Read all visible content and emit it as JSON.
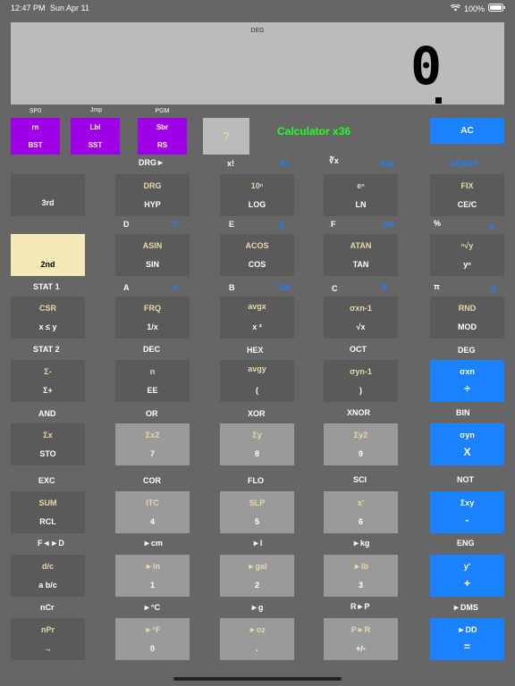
{
  "status_bar": {
    "time": "12:47 PM",
    "date": "Sun Apr 11",
    "battery": "100%"
  },
  "display": {
    "angle_mode": "DEG",
    "value": "0"
  },
  "prog_keys": [
    {
      "label_above": "SP0",
      "top": "rn",
      "bottom": "BST"
    },
    {
      "label_above": "Jmp",
      "top": "Lbl",
      "bottom": "SST"
    },
    {
      "label_above": "PGM",
      "top": "Sbr",
      "bottom": "RS"
    }
  ],
  "help_label": "?",
  "app_title": "Calculator x36",
  "ac_label": "AC",
  "row_labels": {
    "r1": {
      "drg": "DRG►",
      "xfact": "x!",
      "k1": "KI",
      "xrt": "∛x",
      "km": "Km",
      "const": "CONST"
    },
    "r2": {
      "d": "D",
      "c": "C",
      "e": "E",
      "g": "g",
      "f": "F",
      "me": "me",
      "pct": "%",
      "e2": "e"
    },
    "r3": {
      "stat1": "STAT 1",
      "a": "A",
      "h": "h",
      "b": "B",
      "na": "NA",
      "c": "C",
      "r": "R",
      "pi": "π",
      "g": "G"
    },
    "r4": {
      "stat2": "STAT 2",
      "dec": "DEC",
      "hex": "HEX",
      "oct": "OCT",
      "deg": "DEG"
    },
    "r5": {
      "and": "AND",
      "or": "OR",
      "xor": "XOR",
      "xnor": "XNOR",
      "bin": "BIN"
    },
    "r6": {
      "exc": "EXC",
      "cor": "COR",
      "flo": "FLO",
      "sci": "SCI",
      "not": "NOT"
    },
    "r7": {
      "fd": "F◄►D",
      "cm": "►cm",
      "l": "►l",
      "kg": "►kg",
      "eng": "ENG"
    },
    "r8": {
      "ncr": "nCr",
      "c": "►°C",
      "g": "►g",
      "rp": "R►P",
      "dms": "►DMS"
    }
  },
  "keys": {
    "r1": [
      {
        "top": "",
        "main": "3rd"
      },
      {
        "top": "DRG",
        "main": "HYP"
      },
      {
        "top": "10ⁿ",
        "main": "LOG"
      },
      {
        "top": "eⁿ",
        "main": "LN"
      },
      {
        "top": "FIX",
        "main": "CE/C"
      }
    ],
    "r2": [
      {
        "top": "",
        "main": "2nd"
      },
      {
        "top": "ASIN",
        "main": "SIN"
      },
      {
        "top": "ACOS",
        "main": "COS"
      },
      {
        "top": "ATAN",
        "main": "TAN"
      },
      {
        "top": "ⁿ√y",
        "main": "yⁿ"
      }
    ],
    "r3": [
      {
        "top": "CSR",
        "main": "x ≤ y"
      },
      {
        "top": "FRQ",
        "main": "1/x"
      },
      {
        "top": "avgx",
        "main": "x ²"
      },
      {
        "top": "σxn-1",
        "main": "√x"
      },
      {
        "top": "RND",
        "main": "MOD"
      }
    ],
    "r4": [
      {
        "top": "Σ-",
        "main": "Σ+"
      },
      {
        "top": "n",
        "main": "EE"
      },
      {
        "top": "avgy",
        "main": "("
      },
      {
        "top": "σyn-1",
        "main": ")"
      },
      {
        "top": "σxn",
        "main": "÷"
      }
    ],
    "r5": [
      {
        "top": "Σx",
        "main": "STO"
      },
      {
        "top": "Σx2",
        "main": "7"
      },
      {
        "top": "Σy",
        "main": "8"
      },
      {
        "top": "Σy2",
        "main": "9"
      },
      {
        "top": "σyn",
        "main": "X"
      }
    ],
    "r6": [
      {
        "top": "SUM",
        "main": "RCL"
      },
      {
        "top": "ITC",
        "main": "4"
      },
      {
        "top": "SLP",
        "main": "5"
      },
      {
        "top": "x'",
        "main": "6"
      },
      {
        "top": "Σxy",
        "main": "-"
      }
    ],
    "r7": [
      {
        "top": "d/c",
        "main": "a b/c"
      },
      {
        "top": "►in",
        "main": "1"
      },
      {
        "top": "►gal",
        "main": "2"
      },
      {
        "top": "►lb",
        "main": "3"
      },
      {
        "top": "y'",
        "main": "+"
      }
    ],
    "r8": [
      {
        "top": "nPr",
        "main": "→"
      },
      {
        "top": "►°F",
        "main": "0"
      },
      {
        "top": "►oz",
        "main": "."
      },
      {
        "top": "P►R",
        "main": "+/-"
      },
      {
        "top": "►DD",
        "main": "="
      }
    ]
  }
}
